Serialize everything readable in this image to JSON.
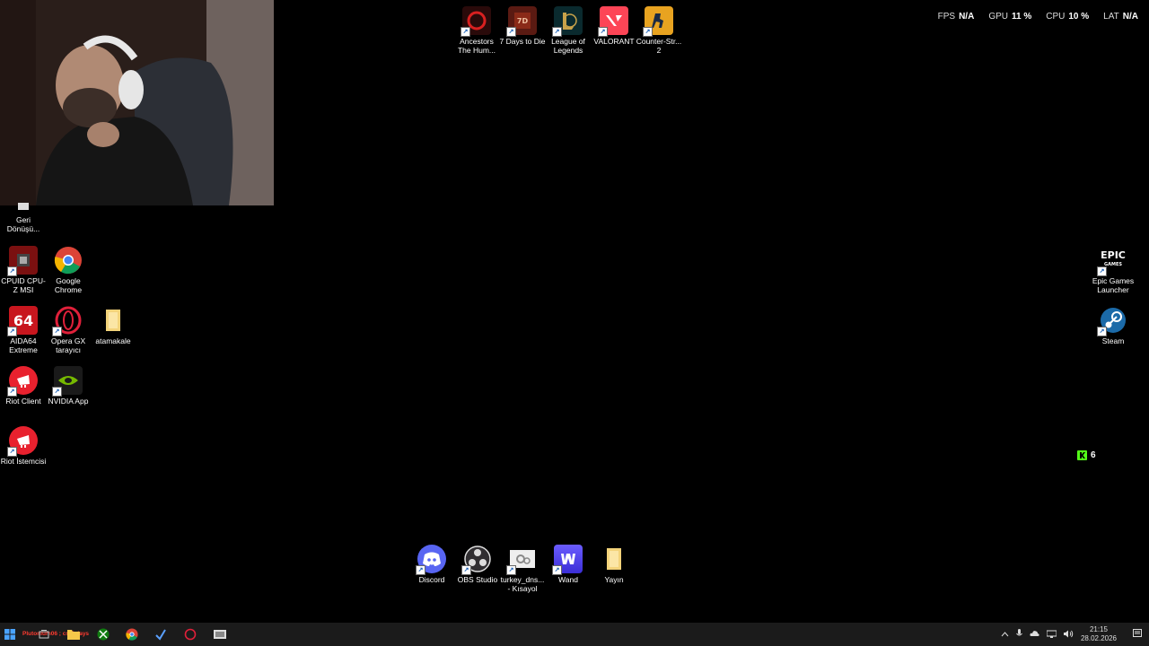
{
  "overlay": {
    "fps_label": "FPS",
    "fps_value": "N/A",
    "gpu_label": "GPU",
    "gpu_value": "11 %",
    "cpu_label": "CPU",
    "cpu_value": "10 %",
    "lat_label": "LAT",
    "lat_value": "N/A"
  },
  "desktop_icons": {
    "ancestors": "Ancestors The Hum...",
    "days7": "7 Days to Die",
    "lol": "League of Legends",
    "valorant": "VALORANT",
    "cs2": "Counter-Str... 2",
    "recycle": "Geri Dönüşü...",
    "cpuz": "CPUID CPU-Z MSI",
    "chrome": "Google Chrome",
    "aida": "AIDA64 Extreme",
    "operagx": "Opera GX tarayıcı",
    "atamakale": "atamakale",
    "riotclient": "Riot Client",
    "nvidia": "NVIDIA App",
    "riotistemcisi": "Riot İstemcisi",
    "epic": "Epic Games Launcher",
    "steam": "Steam",
    "discord": "Discord",
    "obs": "OBS Studio",
    "turkeydns": "turkey_dns... - Kısayol",
    "wand": "Wand",
    "yayin": "Yayın"
  },
  "badge": {
    "count": "6"
  },
  "taskbar": {
    "stream_text": "Plutonium06 ; cs 7 days",
    "time": "21:15",
    "date": "28.02.2026"
  },
  "colors": {
    "desktop_bg": "#000000",
    "taskbar_bg": "#1b1b1b",
    "kick_green": "#53fc18"
  }
}
